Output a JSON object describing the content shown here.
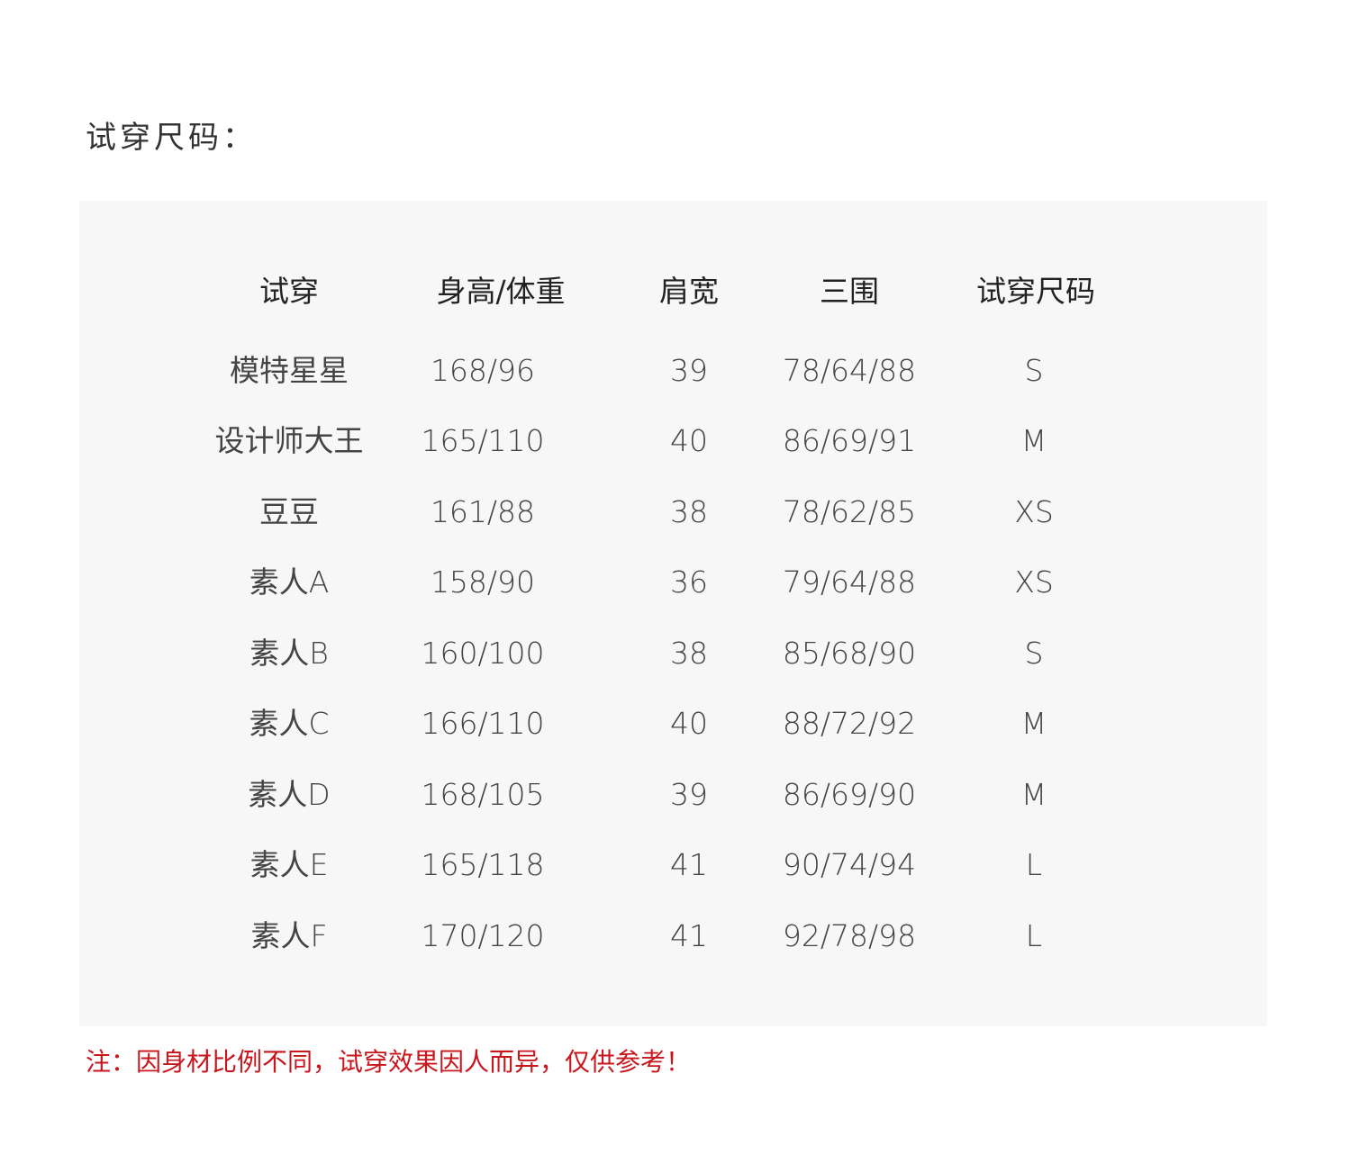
{
  "title": "试穿尺码：",
  "table": {
    "headers": [
      "试穿",
      "身高/体重",
      "肩宽",
      "三围",
      "试穿尺码"
    ],
    "rows": [
      [
        "模特星星",
        "168/96",
        "39",
        "78/64/88",
        "S"
      ],
      [
        "设计师大王",
        "165/110",
        "40",
        "86/69/91",
        "M"
      ],
      [
        "豆豆",
        "161/88",
        "38",
        "78/62/85",
        "XS"
      ],
      [
        "素人A",
        "158/90",
        "36",
        "79/64/88",
        "XS"
      ],
      [
        "素人B",
        "160/100",
        "38",
        "85/68/90",
        "S"
      ],
      [
        "素人C",
        "166/110",
        "40",
        "88/72/92",
        "M"
      ],
      [
        "素人D",
        "168/105",
        "39",
        "86/69/90",
        "M"
      ],
      [
        "素人E",
        "165/118",
        "41",
        "90/74/94",
        "L"
      ],
      [
        "素人F",
        "170/120",
        "41",
        "92/78/98",
        "L"
      ]
    ]
  },
  "footnote": "注：因身材比例不同，试穿效果因人而异，仅供参考！",
  "colors": {
    "panel_background": "#f7f7f7",
    "footnote": "#c8161d",
    "text": "#333333"
  }
}
